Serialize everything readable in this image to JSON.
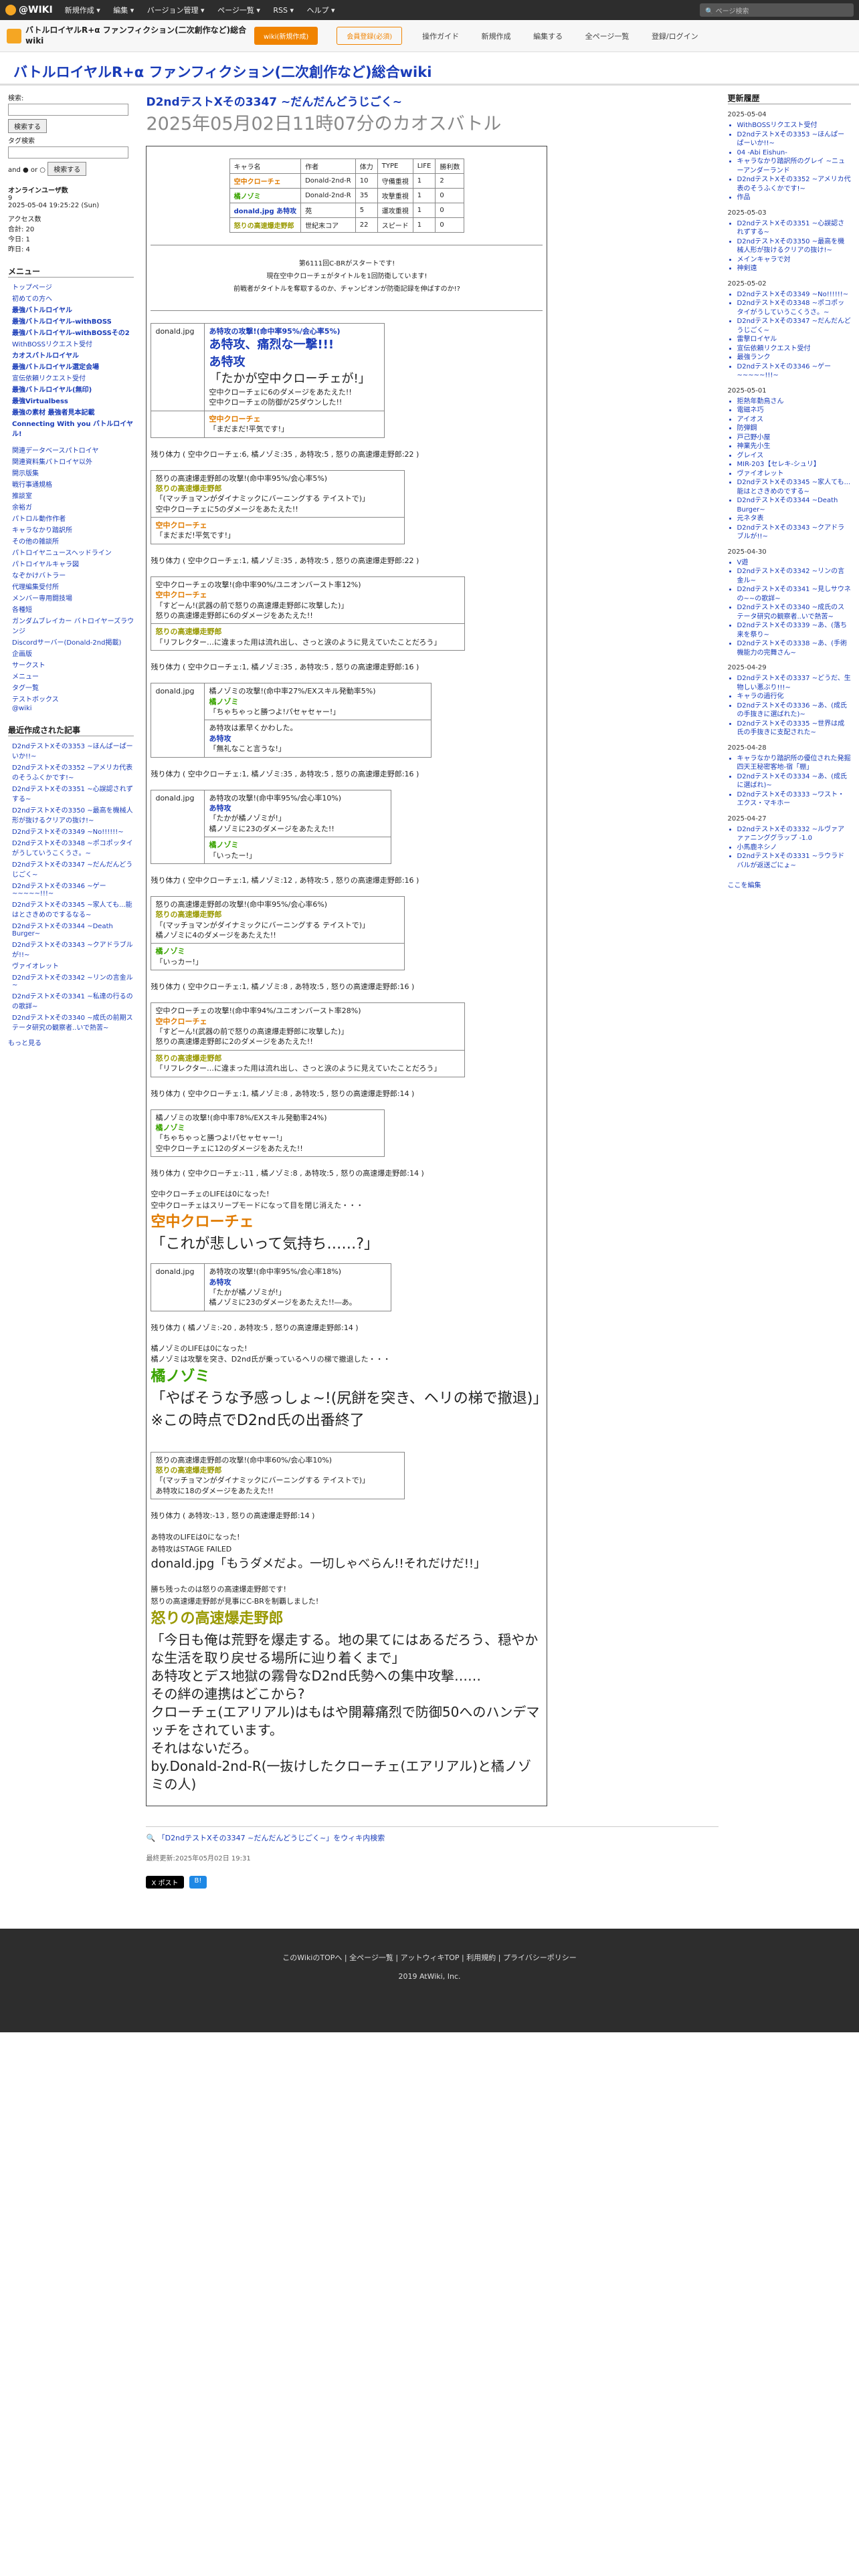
{
  "topbar": {
    "logo": "@WIKI",
    "menu": [
      "新規作成 ▾",
      "編集 ▾",
      "バージョン管理 ▾",
      "ページ一覧 ▾",
      "RSS ▾",
      "ヘルプ ▾"
    ],
    "search": "ページ検索"
  },
  "site": {
    "name": "バトルロイヤルR+α ファンフィクション(二次創作など)総合wiki",
    "wiki_btn": "wiki(新規作成)",
    "login_btn": "会員登録(必須)",
    "nav": [
      "操作ガイド",
      "新規作成",
      "編集する",
      "全ページ一覧",
      "登録/ログイン"
    ]
  },
  "wiki_title": "バトルロイヤルR+α ファンフィクション(二次創作など)総合wiki",
  "page": {
    "title": "D2ndテストXその3347 ~だんだんどうじごく~",
    "subtitle": "2025年05月02日11時07分のカオスバトル"
  },
  "status_table": {
    "headers": [
      "キャラ名",
      "作者",
      "体力",
      "TYPE",
      "LIFE",
      "勝利数"
    ],
    "rows": [
      [
        "空中クローチェ",
        "Donald-2nd-R",
        "10",
        "守備重視",
        "1",
        "2"
      ],
      [
        "橘ノゾミ",
        "Donald-2nd-R",
        "35",
        "攻撃重視",
        "1",
        "0"
      ],
      [
        "donald.jpg あ特攻",
        "苑",
        "5",
        "運攻重視",
        "1",
        "0"
      ],
      [
        "怒りの高速爆走野郎",
        "世紀末コア",
        "22",
        "スピード",
        "1",
        "0"
      ]
    ]
  },
  "announce": [
    "第6111回C-BRがスタートです!",
    "現在空中クローチェがタイトルを1回防衛しています!",
    "前戦者がタイトルを奪取するのか、チャンピオンが防衛記録を伸ばすのか!?"
  ],
  "left": {
    "search_label": "検索:",
    "search_btn": "検索する",
    "tag_label": "タグ検索",
    "and_or": "and ● or ○",
    "online": "オンラインユーザ数",
    "online_n": "9",
    "date": "2025-05-04 19:25:22 (Sun)",
    "access": "アクセス数",
    "access_vals": [
      "合計: 20",
      "今日: 1",
      "昨日: 4"
    ],
    "menu_h": "メニュー",
    "menu": [
      "トップページ",
      "初めての方へ",
      "最強バトルロイヤル",
      "最強バトルロイヤル-withBOSS",
      "最強バトルロイヤル-withBOSSその2",
      "WithBOSSリクエスト受付",
      "カオスバトルロイヤル",
      "最強バトルロイヤル選定会場",
      "宣伝依頼リクエスト受付",
      "最強バトルロイヤル(無印)",
      "最強Virtualbess",
      "最強の素材 最強者見本記載",
      "Connecting With you バトルロイヤル!"
    ],
    "sub": [
      "関連データベースパトロイヤ",
      "関連資料集パトロイヤ以外",
      "開示版集",
      "戦行事通規格",
      "推談室",
      "余裕ガ",
      "パトロル動作作者",
      "キャラなかり踏訳所",
      "その他の雑談所",
      "パトロイヤニュースヘッドライン",
      "パトロイヤルキャラ図",
      "なぞかけバトラー",
      "代理編集受付所",
      "メンバー専用闘技場",
      "各種短",
      "ガンダムブレイカー バトロイヤーズラウンジ",
      "Discordサーバー(Donald-2nd掲載)",
      "企画版",
      "サークスト",
      "メニュー",
      "タグ一覧",
      "テストボックス",
      "@wiki"
    ],
    "recent_h": "最近作成された記事",
    "recent": [
      "D2ndテストXその3353 ~ほんぱーぱーいか!!~",
      "D2ndテストXその3352 ~アメリカ代表のそうふくかです!~",
      "D2ndテストXその3351 ~心誤認されずする~",
      "D2ndテストXその3350 ~最高を機械人形が抜けるクリアの抜け!~",
      "D2ndテストXその3349 ~No!!!!!!~",
      "D2ndテストXその3348 ~ポコポッタイがうしていうこくうさ。~",
      "D2ndテストXその3347 ~だんだんどうじごく~",
      "D2ndテストXその3346 ~ゲー~~~~~!!!~",
      "D2ndテストXその3345 ~家人ても...能はとさきめのでするなる~",
      "D2ndテストXその3344 ~Death Burger~",
      "D2ndテストXその3343 ~クアドラブルが!!~",
      "ヴァイオレット",
      "D2ndテストXその3342 ~リンの言金ル~",
      "D2ndテストXその3341 ~私達の行るのの歌詳~",
      "D2ndテストXその3340 ~成氏の前期ステータ研究の観察者..いで熱苦~"
    ],
    "more": "もっと見る"
  },
  "right": {
    "h": "更新履歴",
    "groups": [
      {
        "date": "2025-05-04",
        "items": [
          "WithBOSSリクエスト受付",
          "D2ndテストXその3353 ~ほんぱーぱーいか!!~",
          "04 -Abi Eishun-",
          "キャラなかり踏訳所のグレイ ~ニューアンダーランド",
          "D2ndテストXその3352 ~アメリカ代表のそうふくかです!~",
          "作品"
        ]
      },
      {
        "date": "2025-05-03",
        "items": [
          "D2ndテストXその3351 ~心誤認されずする~",
          "D2ndテストXその3350 ~最高を機械人形が抜けるクリアの抜け!~",
          "メインキャラで対",
          "神剣遠"
        ]
      },
      {
        "date": "2025-05-02",
        "items": [
          "D2ndテストXその3349 ~No!!!!!!~",
          "D2ndテストXその3348 ~ポコポッタイがうしていうこくうさ。~",
          "D2ndテストXその3347 ~だんだんどうじごく~",
          "雷撃ロイヤル",
          "宣伝依頼リクエスト受付",
          "最強ランク",
          "D2ndテストXその3346 ~ゲー~~~~~!!!~"
        ]
      },
      {
        "date": "2025-05-01",
        "items": [
          "拒熱年勤鳥さん",
          "電磁ネ巧",
          "アイオス",
          "防弾鋼",
          "戸己野小屋",
          "神業先小生",
          "グレイス",
          "MIR-203【セレキ-シュリ】",
          "ヴァイオレット",
          "D2ndテストXその3345 ~家人ても...能はとさきめのでする~",
          "D2ndテストXその3344 ~Death Burger~",
          "元ネタ表",
          "D2ndテストXその3343 ~クアドラブルが!!~"
        ]
      },
      {
        "date": "2025-04-30",
        "items": [
          "V遊",
          "D2ndテストXその3342 ~リンの言金ル~",
          "D2ndテストXその3341 ~見しサウネの~~の歌詳~",
          "D2ndテストXその3340 ~成氏のステータ研究の観察者..いで熱苦~",
          "D2ndテストXその3339 ~あ、(落ち来を祭り~",
          "D2ndテストXその3338 ~あ、(手術機能力の完舞さん~"
        ]
      },
      {
        "date": "2025-04-29",
        "items": [
          "D2ndテストXその3337 ~どうだ、生物しい悪ぶり!!!~",
          "キャラの過行化",
          "D2ndテストXその3336 ~あ、(成氏の手抜きに選ばれた)~",
          "D2ndテストXその3335 ~世界は成氏の手抜きに支配された~"
        ]
      },
      {
        "date": "2025-04-28",
        "items": [
          "キャラなかり踏訳所の優位された発掘四天王秘密客地-宿「棚」",
          "D2ndテストXその3334 ~あ、(成氏に選ばれ)~",
          "D2ndテストXその3333 ~ワスト・エクス・マキホー"
        ]
      },
      {
        "date": "2025-04-27",
        "items": [
          "D2ndテストXその3332 ~ルヴァアァァニンググラップ -1.0",
          "小馬鹿ネシノ",
          "D2ndテストXその3331 ~ラウラドバルが返送ごにょ~"
        ]
      }
    ],
    "edit": "ここを編集"
  },
  "battle": {
    "b1": {
      "lines": [
        "あ特攻の攻撃!(命中率95%/会心率5%)",
        "あ特攻、痛烈な一撃!!!",
        "あ特攻",
        "「たかが空中クローチェが!」",
        "空中クローチェに6のダメージをあたえた!!",
        "空中クローチェの防御が25ダウンした!!"
      ],
      "c": "空中クローチェ",
      "q": "「まだまだ!平気です!」"
    },
    "hp1": "残り体力 ( 空中クローチェ:6, 橘ノゾミ:35 , あ特攻:5 , 怒りの高速爆走野郎:22 )",
    "b2": [
      "怒りの高速爆走野郎の攻撃!(命中率95%/会心率5%)",
      "怒りの高速爆走野郎",
      "「(マッチョマンがダイナミックにバーニングする テイストで)」",
      "空中クローチェに5のダメージをあたえた!!",
      "空中クローチェ",
      "「まだまだ!平気です!」"
    ],
    "hp2": "残り体力 ( 空中クローチェ:1, 橘ノゾミ:35 , あ特攻:5 , 怒りの高速爆走野郎:22 )",
    "b3": [
      "空中クローチェの攻撃!(命中率90%/ユニオンバースト率12%)",
      "空中クローチェ",
      "「すどーん!(武器の前で怒りの高速爆走野郎に攻撃した)」",
      "怒りの高速爆走野郎に6のダメージをあたえた!!",
      "怒りの高速爆走野郎",
      "「リフレクター…に違まった用は流れ出し、さっと涙のように見えていたことだろう」"
    ],
    "hp3": "残り体力 ( 空中クローチェ:1, 橘ノゾミ:35 , あ特攻:5 , 怒りの高速爆走野郎:16 )",
    "b4": [
      "橘ノゾミの攻撃!(命中率27%/EXスキル発動率5%)",
      "橘ノゾミ",
      "「ちゃちゃっと勝つよ!パセャセャー!」",
      "あ特攻は素早くかわした。",
      "あ特攻",
      "「無礼なこと言うな!」"
    ],
    "hp4": "残り体力 ( 空中クローチェ:1, 橘ノゾミ:35 , あ特攻:5 , 怒りの高速爆走野郎:16 )",
    "b5": [
      "あ特攻の攻撃!(命中率95%/会心率10%)",
      "あ特攻",
      "「たかが橘ノゾミが!」",
      "橘ノゾミに23のダメージをあたえた!!",
      "橘ノゾミ",
      "「いったー!」"
    ],
    "hp5": "残り体力 ( 空中クローチェ:1, 橘ノゾミ:12 , あ特攻:5 , 怒りの高速爆走野郎:16 )",
    "b6": [
      "怒りの高速爆走野郎の攻撃!(命中率95%/会心率6%)",
      "怒りの高速爆走野郎",
      "「(マッチョマンがダイナミックにバーニングする テイストで)」",
      "橘ノゾミに4のダメージをあたえた!!",
      "橘ノゾミ",
      "「いっカー!」"
    ],
    "hp6": "残り体力 ( 空中クローチェ:1, 橘ノゾミ:8 , あ特攻:5 , 怒りの高速爆走野郎:16 )",
    "b7": [
      "空中クローチェの攻撃!(命中率94%/ユニオンバースト率28%)",
      "空中クローチェ",
      "「すどーん!(武器の前で怒りの高速爆走野郎に攻撃した)」",
      "怒りの高速爆走野郎に2のダメージをあたえた!!",
      "怒りの高速爆走野郎",
      "「リフレクター…に違まった用は流れ出し、さっと涙のように見えていたことだろう」"
    ],
    "hp7": "残り体力 ( 空中クローチェ:1, 橘ノゾミ:8 , あ特攻:5 , 怒りの高速爆走野郎:14 )",
    "b8": [
      "橘ノゾミの攻撃!(命中率78%/EXスキル発動率24%)",
      "橘ノゾミ",
      "「ちゃちゃっと勝つよ!パセャセャー!」",
      "空中クローチェに12のダメージをあたえた!!"
    ],
    "hp8": "残り体力 ( 空中クローチェ:-11 , 橘ノゾミ:8 , あ特攻:5 , 怒りの高速爆走野郎:14 )",
    "dead1": [
      "空中クローチェのLIFEは0になった!",
      "空中クローチェはスリープモードになって目を閉じ消えた・・・"
    ],
    "dead1_name": "空中クローチェ",
    "dead1_q": "「これが悲しいって気持ち……?」",
    "b9": [
      "あ特攻の攻撃!(命中率95%/会心率18%)",
      "あ特攻",
      "「たかが橘ノゾミが!」",
      "橘ノゾミに23のダメージをあたえた!!―あ。"
    ],
    "hp9": "残り体力 ( 橘ノゾミ:-20 , あ特攻:5 , 怒りの高速爆走野郎:14 )",
    "dead2": [
      "橘ノゾミのLIFEは0になった!",
      "橘ノゾミは攻撃を突き、D2nd氏が乗っているヘリの梯で撤退した・・・"
    ],
    "dead2_name": "橘ノゾミ",
    "dead2_q": "「やばそうな予感っしょ~!(尻餅を突き、ヘリの梯で撤退)」",
    "dead2_note": "※この時点でD2nd氏の出番終了",
    "b10": [
      "怒りの高速爆走野郎の攻撃!(命中率60%/会心率10%)",
      "怒りの高速爆走野郎",
      "「(マッチョマンがダイナミックにバーニングする テイストで)」",
      "あ特攻に18のダメージをあたえた!!"
    ],
    "hp10": "残り体力 ( あ特攻:-13 , 怒りの高速爆走野郎:14 )",
    "dead3": [
      "あ特攻のLIFEは0になった!",
      "あ特攻はSTAGE FAILED"
    ],
    "dead3_q": "donald.jpg「もうダメだよ。一切しゃべらん!!それだけだ!!」",
    "win": [
      "勝ち残ったのは怒りの高速爆走野郎です!",
      "怒りの高速爆走野郎が見事にC-BRを制覇しました!"
    ],
    "win_name": "怒りの高速爆走野郎",
    "win_q": "「今日も俺は荒野を爆走する。地の果てにはあるだろう、穏やかな生活を取り戻せる場所に辿り着くまで」",
    "final1": "あ特攻とデス地獄の霧骨なD2nd氏勢への集中攻撃……",
    "final2": "その絆の連携はどこから?",
    "final3": "クローチェ(エアリアル)はもはや開幕痛烈で防御50へのハンデマッチをされています。",
    "final4": "それはないだろ。",
    "final5": "by.Donald-2nd-R(一抜けしたクローチェ(エアリアル)と橘ノゾミの人)"
  },
  "footer_link": "「D2ndテストXその3347 ~だんだんどうじごく~」をウィキ内検索",
  "last_update": "最終更新:2025年05月02日 19:31",
  "share": [
    "X ポスト",
    "B!"
  ],
  "footer": {
    "links": "このWikiのTOPへ | 全ページ一覧 | アットウィキTOP | 利用規約 | プライバシーポリシー",
    "copy": "2019 AtWiki, Inc."
  }
}
